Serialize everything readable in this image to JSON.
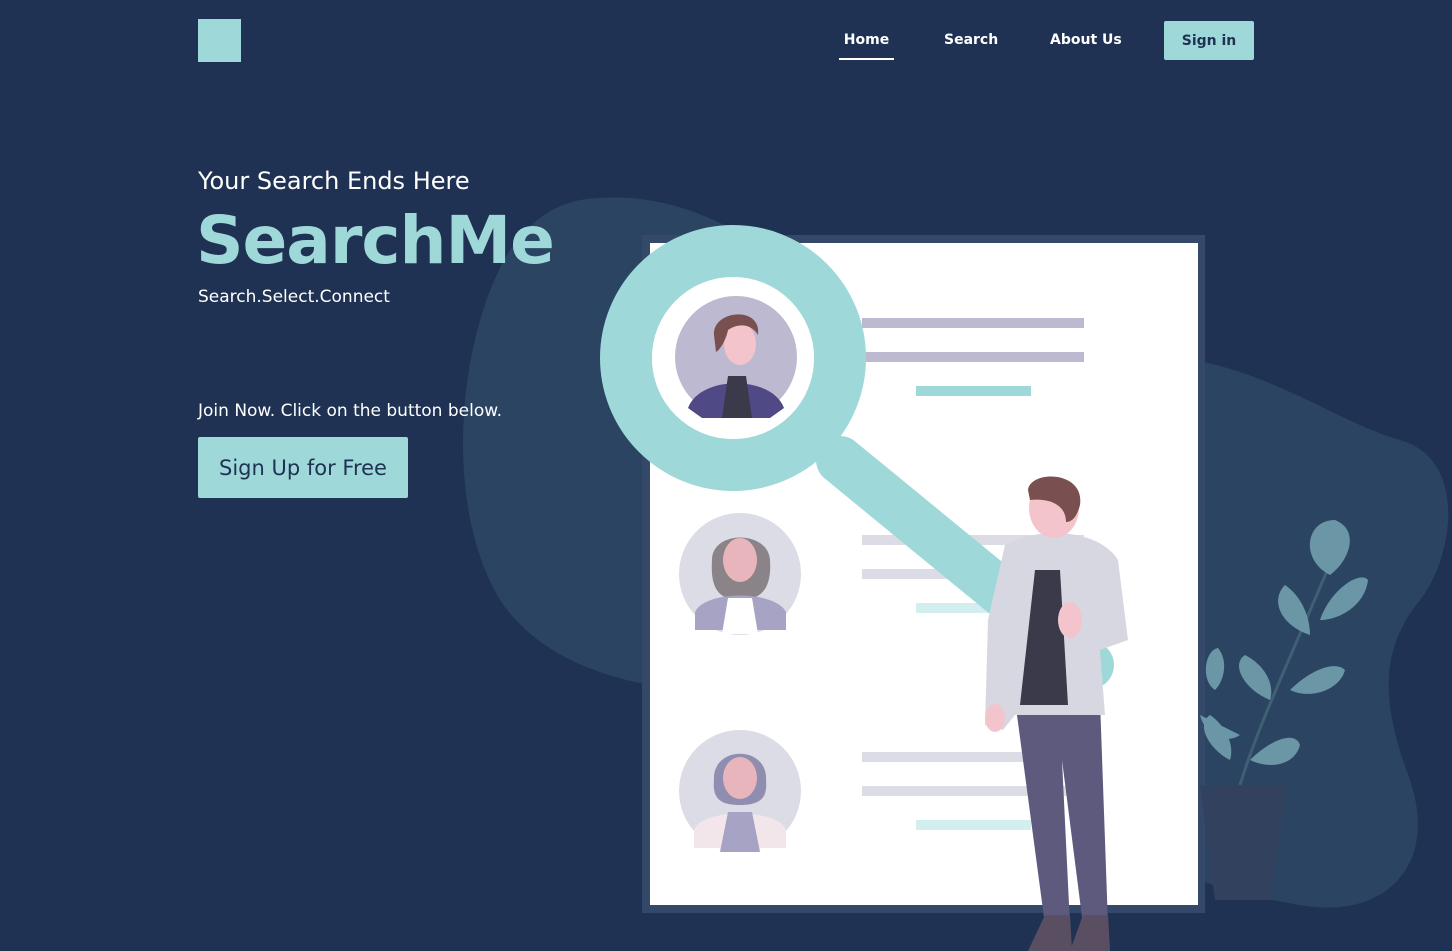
{
  "header": {
    "nav": {
      "home_label": "Home",
      "search_label": "Search",
      "about_label": "About Us"
    },
    "signin_label": "Sign in"
  },
  "hero": {
    "tagline": "Your Search Ends Here",
    "brand": "SearchMe",
    "subtitle": "Search.Select.Connect",
    "join_text": "Join Now. Click on the button below.",
    "signup_label": "Sign Up for Free"
  },
  "colors": {
    "background": "#1f3253",
    "accent": "#9fd8d8",
    "blob": "#2b4462",
    "text": "#ffffff"
  }
}
